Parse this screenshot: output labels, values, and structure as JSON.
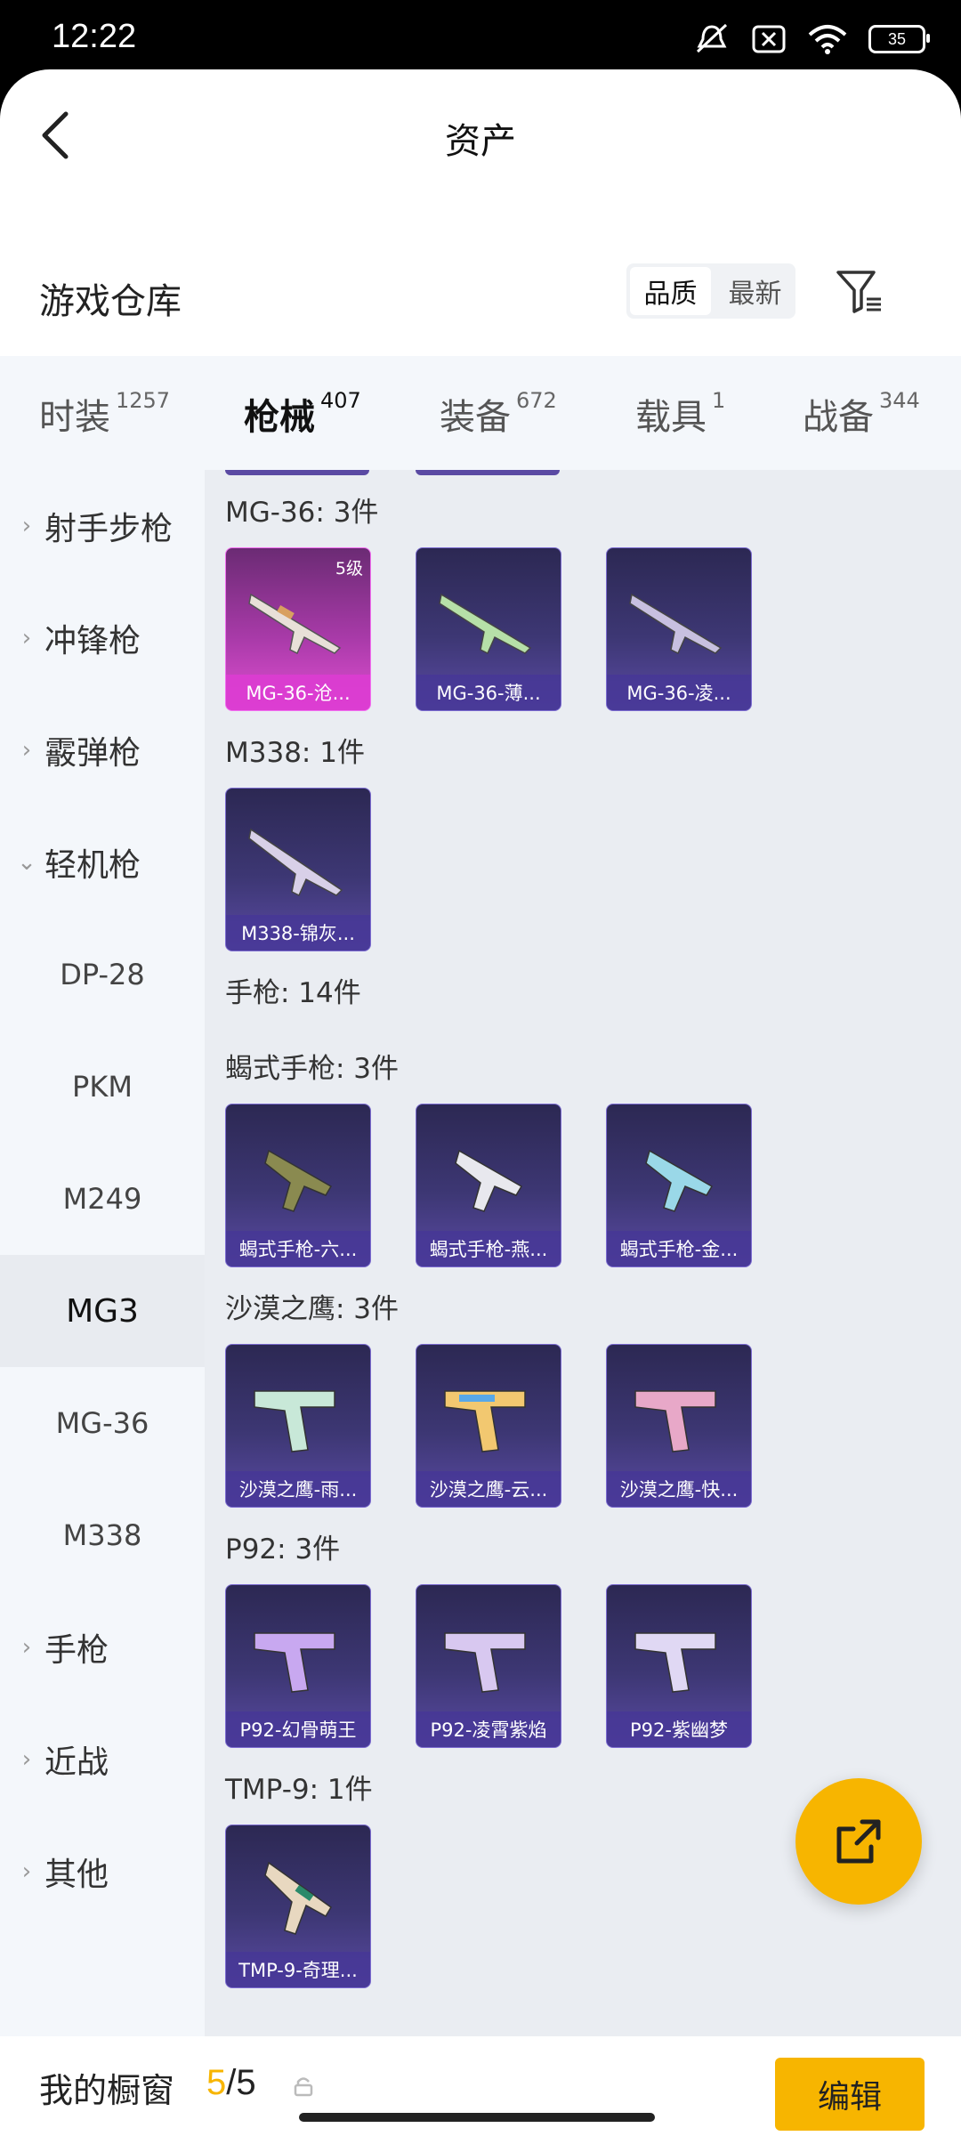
{
  "status_bar": {
    "time": "12:22",
    "battery": "35"
  },
  "header": {
    "title": "资产"
  },
  "section": {
    "title": "游戏仓库",
    "sort_quality": "品质",
    "sort_newest": "最新"
  },
  "tabs": [
    {
      "label": "时装",
      "count": "1257"
    },
    {
      "label": "枪械",
      "count": "407"
    },
    {
      "label": "装备",
      "count": "672"
    },
    {
      "label": "载具",
      "count": "1"
    },
    {
      "label": "战备",
      "count": "344"
    }
  ],
  "categories": {
    "sniper": "射手步枪",
    "smg": "冲锋枪",
    "shotgun": "霰弹枪",
    "lmg": "轻机枪",
    "pistol": "手枪",
    "melee": "近战",
    "other": "其他"
  },
  "lmg_items": [
    "DP-28",
    "PKM",
    "M249",
    "MG3",
    "MG-36",
    "M338"
  ],
  "groups": {
    "mg36": "MG-36: 3件",
    "m338": "M338: 1件",
    "pistol_total": "手枪: 14件",
    "scorpion": "蝎式手枪: 3件",
    "deagle": "沙漠之鹰: 3件",
    "p92": "P92: 3件",
    "tmp9": "TMP-9: 1件"
  },
  "cards": {
    "mg36": [
      "MG-36-沧...",
      "MG-36-薄...",
      "MG-36-凌..."
    ],
    "mg36_level": "5级",
    "m338": [
      "M338-锦灰..."
    ],
    "scorpion": [
      "蝎式手枪-六...",
      "蝎式手枪-燕...",
      "蝎式手枪-金..."
    ],
    "deagle": [
      "沙漠之鹰-雨...",
      "沙漠之鹰-云...",
      "沙漠之鹰-快..."
    ],
    "p92": [
      "P92-幻骨萌王",
      "P92-凌霄紫焰",
      "P92-紫幽梦"
    ],
    "tmp9": [
      "TMP-9-奇理..."
    ]
  },
  "bottom": {
    "label": "我的橱窗",
    "current": "5",
    "total": "/5",
    "edit": "编辑"
  },
  "colors": {
    "accent": "#f7b500",
    "card_purple": "#3d3774",
    "card_gold": "#e04fd2"
  }
}
